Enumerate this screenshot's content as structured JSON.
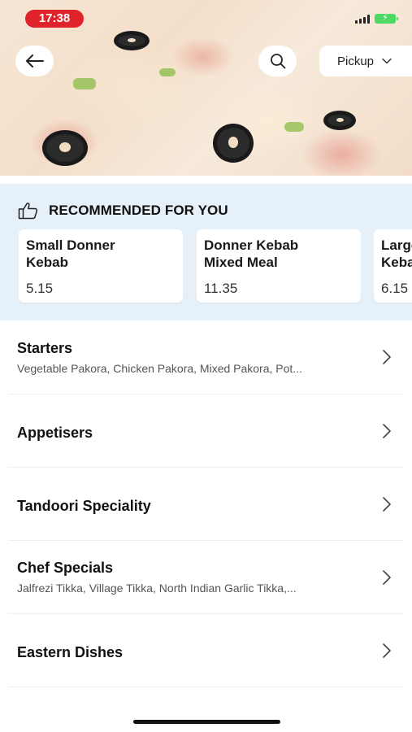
{
  "status_bar": {
    "time": "17:38"
  },
  "header": {
    "pickup_label": "Pickup"
  },
  "icons": {
    "back": "arrow-left-icon",
    "search": "search-icon",
    "dropdown": "chevron-down-icon",
    "recommended": "thumbs-up-icon",
    "category": "chevron-right-icon"
  },
  "colors": {
    "time_pill": "#e0232b",
    "recommended_bg": "#e6f0f8",
    "battery": "#4cd964"
  },
  "recommended": {
    "title": "RECOMMENDED FOR YOU",
    "items": [
      {
        "name": "Small Donner\nKebab",
        "price": "5.15"
      },
      {
        "name": " Donner Kebab\nMixed Meal",
        "price": "11.35"
      },
      {
        "name": "Large Donner\nKebab",
        "price": "6.15"
      }
    ]
  },
  "categories": [
    {
      "title": "Starters",
      "subtitle": "Vegetable Pakora, Chicken Pakora, Mixed Pakora, Pot..."
    },
    {
      "title": "Appetisers",
      "subtitle": ""
    },
    {
      "title": "Tandoori Speciality",
      "subtitle": ""
    },
    {
      "title": "Chef Specials",
      "subtitle": "Jalfrezi Tikka, Village Tikka, North Indian Garlic Tikka,..."
    },
    {
      "title": "Eastern Dishes",
      "subtitle": ""
    }
  ]
}
